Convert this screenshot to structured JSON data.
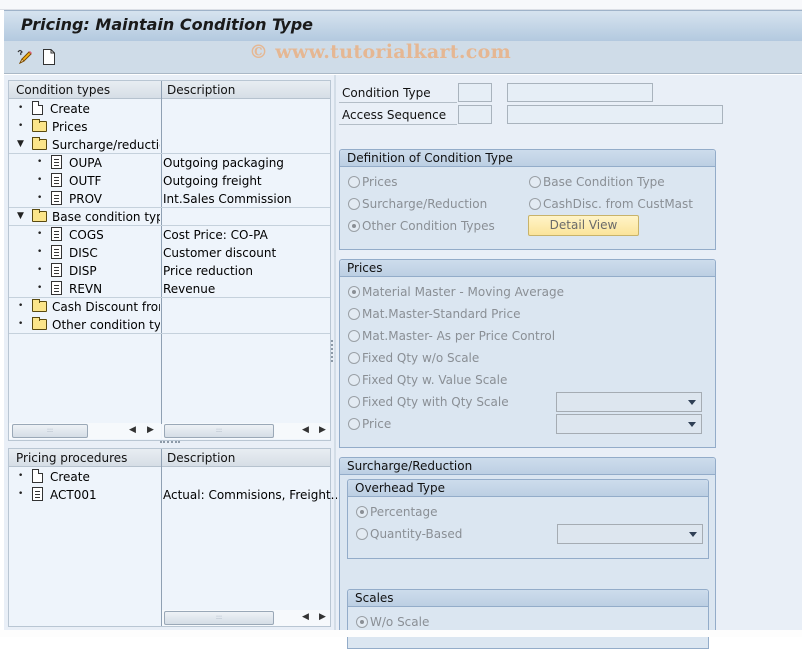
{
  "title": "Pricing: Maintain Condition Type",
  "watermark": "© www.tutorialkart.com",
  "toolbar": {
    "icons": [
      "change-display-icon",
      "create-icon"
    ]
  },
  "condition_tree": {
    "headers": {
      "col1": "Condition types",
      "col2": "Description"
    },
    "rows": [
      {
        "name": "Create",
        "desc": "",
        "type": "create",
        "level": 0
      },
      {
        "name": "Prices",
        "desc": "",
        "type": "folder",
        "level": 0
      },
      {
        "name": "Surcharge/reductions",
        "desc": "",
        "type": "folder-open",
        "level": 0
      },
      {
        "name": "OUPA",
        "desc": "Outgoing packaging",
        "type": "item",
        "level": 1
      },
      {
        "name": "OUTF",
        "desc": "Outgoing freight",
        "type": "item",
        "level": 1
      },
      {
        "name": "PROV",
        "desc": "Int.Sales Commission",
        "type": "item",
        "level": 1
      },
      {
        "name": "Base condition types",
        "desc": "",
        "type": "folder-open",
        "level": 0
      },
      {
        "name": "COGS",
        "desc": "Cost Price: CO-PA",
        "type": "item",
        "level": 1
      },
      {
        "name": "DISC",
        "desc": "Customer discount",
        "type": "item",
        "level": 1
      },
      {
        "name": "DISP",
        "desc": "Price reduction",
        "type": "item",
        "level": 1
      },
      {
        "name": "REVN",
        "desc": "Revenue",
        "type": "item",
        "level": 1
      },
      {
        "name": "Cash Discount from",
        "desc": "",
        "type": "folder",
        "level": 0
      },
      {
        "name": "Other condition types",
        "desc": "",
        "type": "folder",
        "level": 0
      }
    ]
  },
  "procedure_tree": {
    "headers": {
      "col1": "Pricing procedures",
      "col2": "Description"
    },
    "rows": [
      {
        "name": "Create",
        "desc": "",
        "type": "create"
      },
      {
        "name": "ACT001",
        "desc": "Actual: Commisions, Freight...",
        "type": "item"
      }
    ]
  },
  "form": {
    "condition_type_label": "Condition Type",
    "condition_type_value": "",
    "condition_type_desc": "",
    "access_sequence_label": "Access Sequence",
    "access_sequence_value": "",
    "access_sequence_desc": ""
  },
  "definition_group": {
    "title": "Definition of Condition Type",
    "options": [
      {
        "label": "Prices",
        "selected": false
      },
      {
        "label": "Base Condition Type",
        "selected": false
      },
      {
        "label": "Surcharge/Reduction",
        "selected": false
      },
      {
        "label": "CashDisc. from CustMast",
        "selected": false
      },
      {
        "label": "Other Condition Types",
        "selected": true
      }
    ],
    "detail_button": "Detail View"
  },
  "prices_group": {
    "title": "Prices",
    "options": [
      {
        "label": "Material Master - Moving Average",
        "selected": true
      },
      {
        "label": "Mat.Master-Standard Price",
        "selected": false
      },
      {
        "label": "Mat.Master- As per Price Control",
        "selected": false
      },
      {
        "label": "Fixed Qty w/o Scale",
        "selected": false
      },
      {
        "label": "Fixed Qty w. Value Scale",
        "selected": false
      },
      {
        "label": "Fixed Qty with Qty Scale",
        "selected": false
      },
      {
        "label": "Price",
        "selected": false
      }
    ],
    "dropdown1_value": "",
    "dropdown2_value": ""
  },
  "surcharge_group": {
    "title": "Surcharge/Reduction",
    "overhead": {
      "title": "Overhead Type",
      "options": [
        {
          "label": "Percentage",
          "selected": true
        },
        {
          "label": "Quantity-Based",
          "selected": false
        }
      ],
      "dropdown_value": ""
    },
    "scales": {
      "title": "Scales",
      "options": [
        {
          "label": "W/o Scale",
          "selected": true
        }
      ]
    }
  },
  "colors": {
    "title_bar": "#b3c9df",
    "toolbar": "#cfdce8",
    "background": "#e9eff7",
    "group_border": "#93acc9",
    "button": "#fbe49a",
    "watermark": "#e8b48a"
  }
}
